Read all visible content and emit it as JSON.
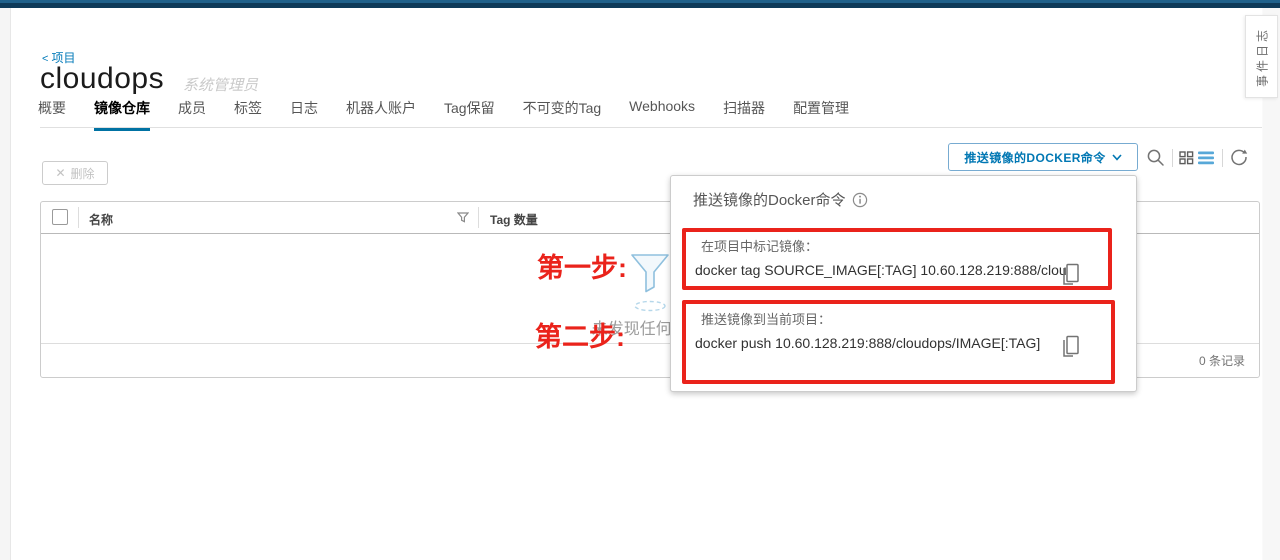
{
  "colors": {
    "accent_blue": "#0072a3",
    "topbar_dark": "#0e3a59",
    "annotation_red": "#ea231b",
    "empty_funnel_blue": "#8fc0de"
  },
  "breadcrumb": {
    "arrow": "<",
    "label": "项目"
  },
  "header": {
    "title": "cloudops",
    "role": "系统管理员"
  },
  "tabs": [
    {
      "label": "概要"
    },
    {
      "label": "镜像仓库"
    },
    {
      "label": "成员"
    },
    {
      "label": "标签"
    },
    {
      "label": "日志"
    },
    {
      "label": "机器人账户"
    },
    {
      "label": "Tag保留"
    },
    {
      "label": "不可变的Tag"
    },
    {
      "label": "Webhooks"
    },
    {
      "label": "扫描器"
    },
    {
      "label": "配置管理"
    }
  ],
  "toolbar": {
    "delete": {
      "icon": "✕",
      "label": "删除"
    },
    "push_command_button": {
      "label": "推送镜像的DOCKER命令"
    },
    "icons": {
      "search": "magnifier",
      "card_view": "grid-squares",
      "list_view": "horizontal-bars",
      "refresh": "circular-arrow"
    }
  },
  "grid": {
    "columns": [
      {
        "label": "名称"
      },
      {
        "label": "Tag 数量"
      }
    ],
    "empty_text": "未发现任何镜像!",
    "footer_records": "0 条记录"
  },
  "popup": {
    "title": "推送镜像的Docker命令",
    "info_icon": "info-circle",
    "sections": [
      {
        "label": "在项目中标记镜像：",
        "command": "docker tag SOURCE_IMAGE[:TAG] 10.60.128.219:888/clou",
        "copy_icon": "clipboard"
      },
      {
        "label": "推送镜像到当前项目：",
        "command": "docker push 10.60.128.219:888/cloudops/IMAGE[:TAG]",
        "copy_icon": "clipboard"
      }
    ]
  },
  "annotations": {
    "step1": "第一步:",
    "step2": "第二步:"
  },
  "event_log_tab": {
    "label": "事件日志"
  }
}
